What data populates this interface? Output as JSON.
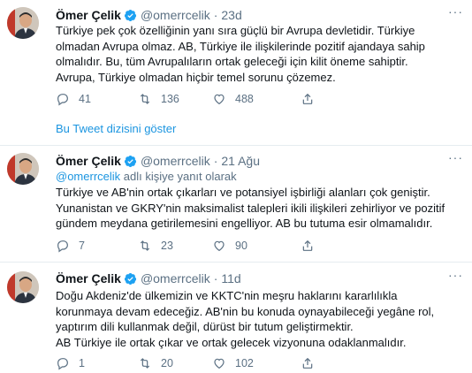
{
  "colors": {
    "link": "#1b95e0",
    "muted": "#5b7083",
    "verified": "#1da1f2",
    "divider": "#e6ecf0"
  },
  "tweets": [
    {
      "name": "Ömer Çelik",
      "handle": "@omerrcelik",
      "dot": "·",
      "time": "23d",
      "more": "···",
      "reply_prefix": "",
      "reply_mention": "",
      "reply_suffix": "",
      "lines": [
        "Türkiye pek çok özelliğinin yanı sıra güçlü bir Avrupa devletidir. Türkiye",
        "olmadan Avrupa olmaz. AB, Türkiye ile ilişkilerinde pozitif ajandaya sahip",
        "olmalıdır. Bu, tüm Avrupalıların ortak geleceği için kilit öneme sahiptir.",
        "Avrupa, Türkiye olmadan hiçbir temel sorunu çözemez."
      ],
      "replies": "41",
      "retweets": "136",
      "likes": "488"
    },
    {
      "name": "Ömer Çelik",
      "handle": "@omerrcelik",
      "dot": "·",
      "time": "21 Ağu",
      "more": "···",
      "reply_prefix": "",
      "reply_mention": "@omerrcelik",
      "reply_suffix": " adlı kişiye yanıt olarak",
      "lines": [
        "Türkiye ve AB'nin ortak çıkarları ve potansiyel işbirliği alanları çok geniştir.",
        "Yunanistan ve GKRY'nin maksimalist talepleri ikili ilişkileri zehirliyor ve pozitif",
        "gündem meydana getirilemesini engelliyor. AB bu tutuma esir olmamalıdır."
      ],
      "replies": "7",
      "retweets": "23",
      "likes": "90"
    },
    {
      "name": "Ömer Çelik",
      "handle": "@omerrcelik",
      "dot": "·",
      "time": "11d",
      "more": "···",
      "reply_prefix": "",
      "reply_mention": "",
      "reply_suffix": "",
      "lines": [
        "Doğu Akdeniz'de ülkemizin ve KKTC'nin meşru haklarını kararlılıkla",
        "korunmaya devam edeceğiz. AB'nin bu konuda oynayabileceği yegâne rol,",
        "yaptırım dili kullanmak değil, dürüst bir tutum geliştirmektir.",
        "AB Türkiye ile ortak çıkar ve ortak gelecek vizyonuna odaklanmalıdır."
      ],
      "replies": "1",
      "retweets": "20",
      "likes": "102"
    }
  ],
  "thread_link": "Bu Tweet dizisini göster"
}
